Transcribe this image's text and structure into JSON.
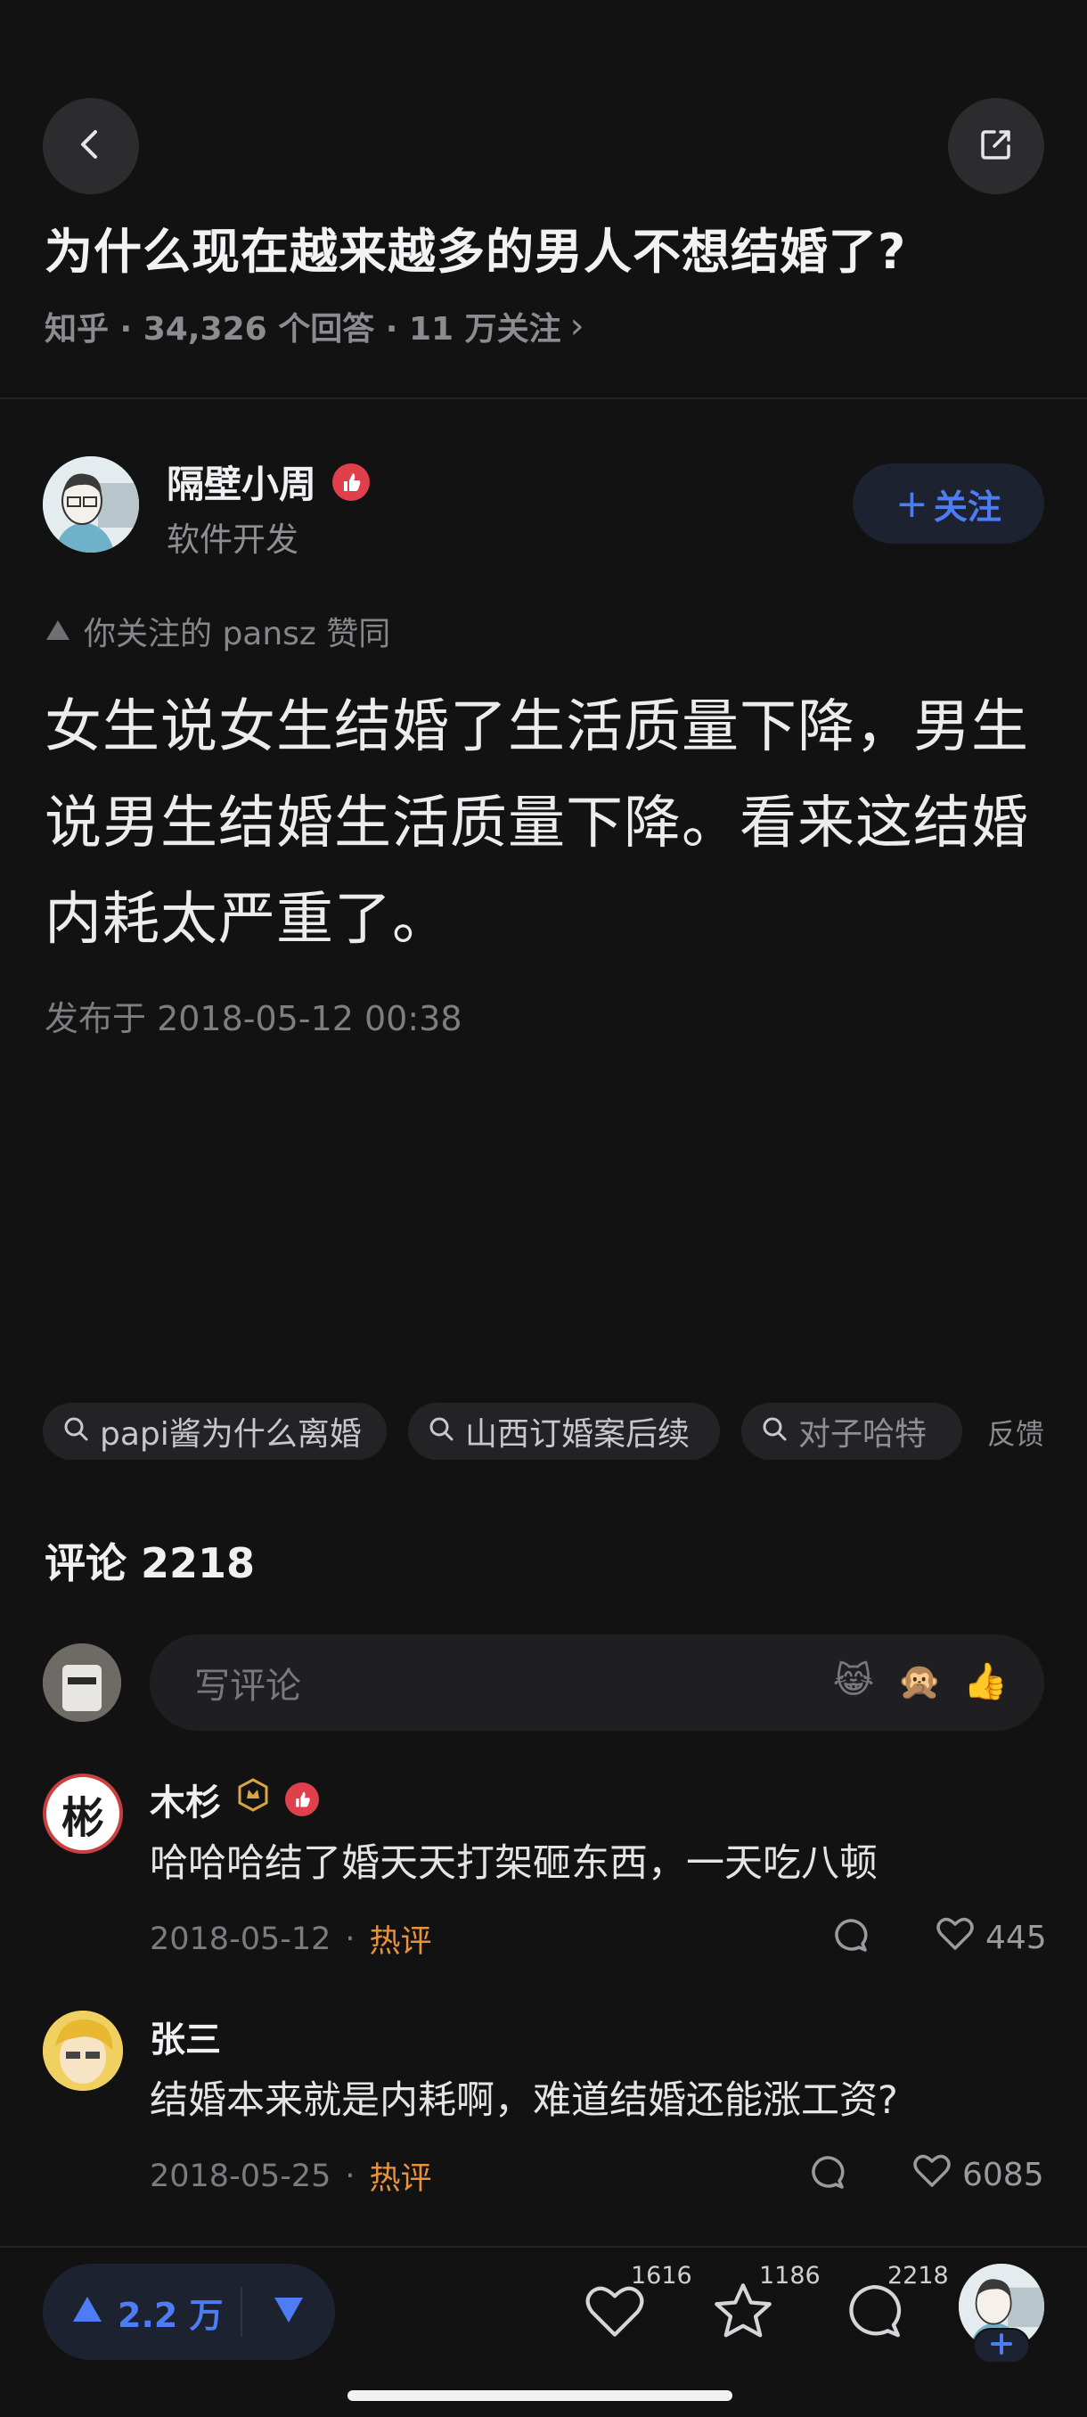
{
  "header": {
    "back_icon": "chevron-left-icon",
    "share_icon": "external-share-icon",
    "question_title": "为什么现在越来越多的男人不想结婚了?",
    "question_meta": "知乎 · 34,326 个回答 · 11 万关注",
    "meta_chevron": "›"
  },
  "author": {
    "name": "隔壁小周",
    "subtitle": "软件开发",
    "follow_label": "关注",
    "follow_plus": "+"
  },
  "answer": {
    "endorsement": "你关注的 pansz 赞同",
    "text": "女生说女生结婚了生活质量下降，男生说男生结婚生活质量下降。看来这结婚内耗太严重了。",
    "published": "发布于 2018-05-12 00:38"
  },
  "search_chips": [
    {
      "label": "papi酱为什么离婚"
    },
    {
      "label": "山西订婚案后续"
    },
    {
      "label": "对子哈特"
    }
  ],
  "feedback_label": "反馈",
  "comments": {
    "title": "评论 2218",
    "input_placeholder": "写评论",
    "emojis": [
      "😹",
      "🙊",
      "👍"
    ],
    "items": [
      {
        "name": "木杉",
        "text": "哈哈哈结了婚天天打架砸东西，一天吃八顿",
        "date": "2018-05-12",
        "sep": "·",
        "tag": "热评",
        "likes": "445",
        "avatar_char": "彬"
      },
      {
        "name": "张三",
        "text": "结婚本来就是内耗啊，难道结婚还能涨工资?",
        "date": "2018-05-25",
        "sep": "·",
        "tag": "热评",
        "likes": "6085"
      }
    ]
  },
  "bottom_bar": {
    "vote_count": "2.2 万",
    "like_count": "1616",
    "favorite_count": "1186",
    "comment_count": "2218",
    "colors": {
      "accent": "#4e7cf4",
      "background": "#121213",
      "hot": "#e8933a"
    }
  }
}
